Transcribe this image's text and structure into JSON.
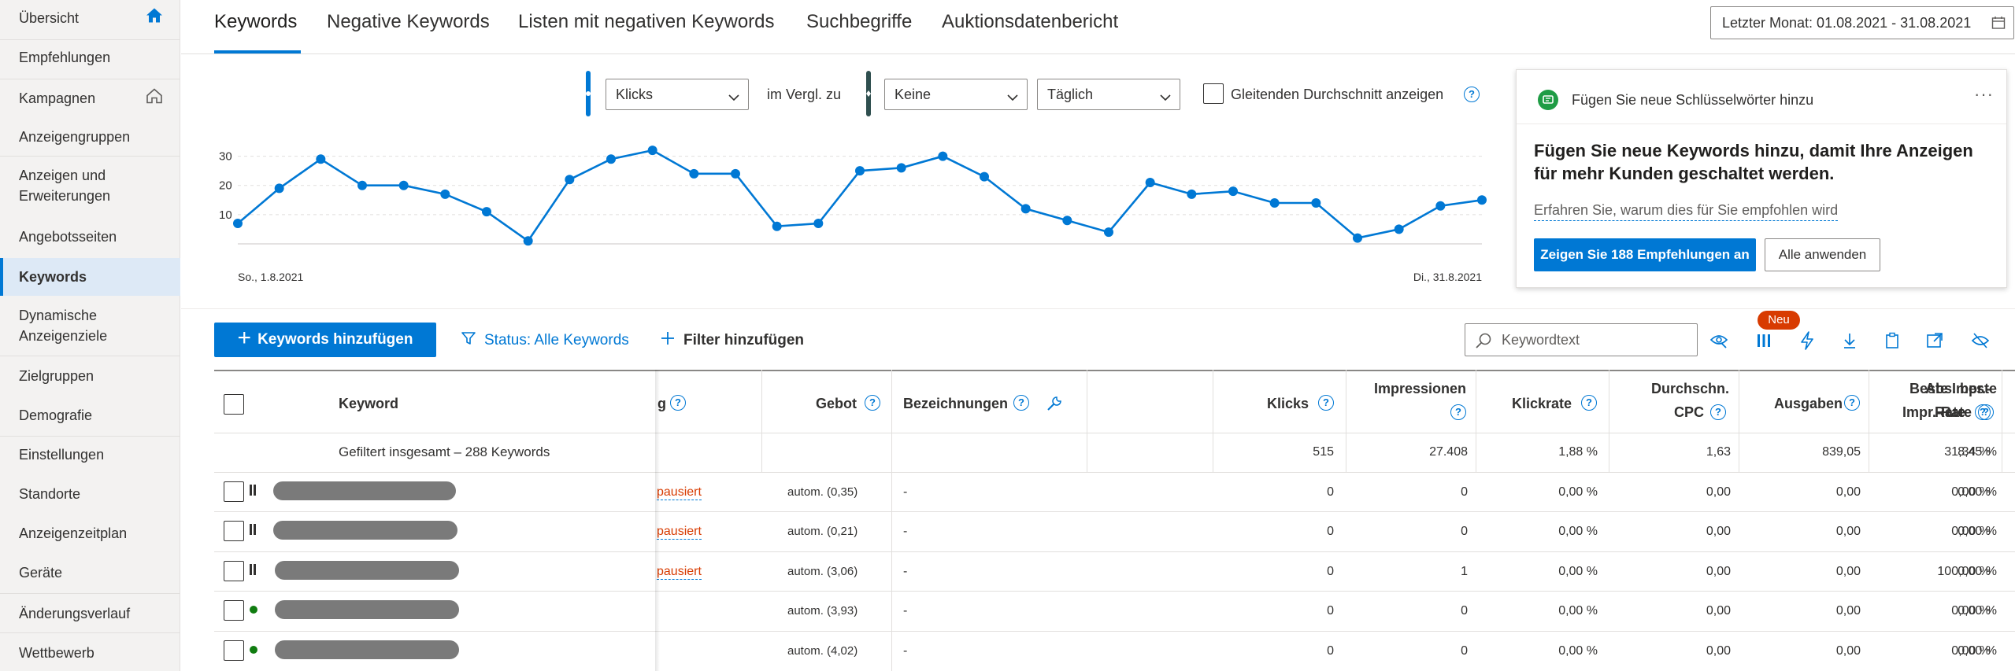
{
  "sidebar": {
    "items": [
      {
        "label": "Übersicht",
        "icon": "home-filled-icon"
      },
      {
        "label": "Empfehlungen"
      },
      {
        "label": "Kampagnen",
        "icon": "home-outline-icon"
      },
      {
        "label": "Anzeigengruppen"
      },
      {
        "label": "Anzeigen und Erweiterungen"
      },
      {
        "label": "Angebotsseiten"
      },
      {
        "label": "Keywords",
        "active": true
      },
      {
        "label": "Dynamische Anzeigenziele"
      },
      {
        "label": "Zielgruppen"
      },
      {
        "label": "Demografie"
      },
      {
        "label": "Einstellungen"
      },
      {
        "label": "Standorte"
      },
      {
        "label": "Anzeigenzeitplan"
      },
      {
        "label": "Geräte"
      },
      {
        "label": "Änderungsverlauf"
      },
      {
        "label": "Wettbewerb"
      }
    ]
  },
  "tabs": [
    {
      "label": "Keywords",
      "active": true
    },
    {
      "label": "Negative Keywords"
    },
    {
      "label": "Listen mit negativen Keywords"
    },
    {
      "label": "Suchbegriffe"
    },
    {
      "label": "Auktionsdatenbericht"
    }
  ],
  "date_range": "Letzter Monat: 01.08.2021 - 31.08.2021",
  "chart_controls": {
    "metric": "Klicks",
    "compare_label": "im Vergl. zu",
    "compare_metric": "Keine",
    "granularity": "Täglich",
    "moving_average_label": "Gleitenden Durchschnitt anzeigen"
  },
  "chart_data": {
    "type": "line",
    "x_start_label": "So., 1.8.2021",
    "x_end_label": "Di., 31.8.2021",
    "y_ticks": [
      "10",
      "20",
      "30"
    ],
    "ylim": [
      0,
      35
    ],
    "grid": true,
    "series": [
      {
        "color": "#0078d4",
        "values": [
          7,
          19,
          29,
          20,
          20,
          17,
          11,
          1,
          22,
          29,
          32,
          24,
          24,
          6,
          7,
          25,
          26,
          30,
          23,
          12,
          8,
          4,
          21,
          17,
          18,
          14,
          14,
          2,
          5,
          13,
          15
        ]
      }
    ]
  },
  "recommendation": {
    "title": "Fügen Sie neue Schlüsselwörter hinzu",
    "headline": "Fügen Sie neue Keywords hinzu, damit Ihre Anzeigen für mehr Kunden geschaltet werden.",
    "link": "Erfahren Sie, warum dies für Sie empfohlen wird",
    "primary_button": "Zeigen Sie 188 Empfehlungen an",
    "secondary_button": "Alle anwenden",
    "more": "···"
  },
  "toolbar": {
    "add_keywords": "Keywords hinzufügen",
    "status_filter": "Status: Alle Keywords",
    "add_filter": "Filter hinzufügen",
    "search_placeholder": "Keywordtext",
    "new_badge": "Neu"
  },
  "table": {
    "headers": {
      "keyword": "Keyword",
      "status_partial": "g",
      "bid": "Gebot",
      "labels": "Bezeichnungen",
      "clicks": "Klicks",
      "impressions_1": "Impressionen",
      "ctr": "Klickrate",
      "avg_cpc_1": "Durchschn.",
      "avg_cpc_2": "CPC",
      "spend": "Ausgaben",
      "top_impr_1": "Beste Impr.-",
      "top_impr_2": "Rate",
      "abs_top_1": "Abs. beste",
      "abs_top_2": "Impr.-Rate"
    },
    "totals": {
      "label": "Gefiltert insgesamt – 288 Keywords",
      "clicks": "515",
      "impressions": "27.408",
      "ctr": "1,88 %",
      "avg_cpc": "1,63",
      "spend": "839,05",
      "top_impr": "31,34 %",
      "abs_top": "8,45 %"
    },
    "rows": [
      {
        "state": "paused",
        "status": "pausiert",
        "bid": "autom. (0,35)",
        "labels": "-",
        "clicks": "0",
        "impressions": "0",
        "ctr": "0,00 %",
        "avg_cpc": "0,00",
        "spend": "0,00",
        "top_impr": "0,00 %",
        "abs_top": "0,00 %"
      },
      {
        "state": "paused",
        "status": "pausiert",
        "bid": "autom. (0,21)",
        "labels": "-",
        "clicks": "0",
        "impressions": "0",
        "ctr": "0,00 %",
        "avg_cpc": "0,00",
        "spend": "0,00",
        "top_impr": "0,00 %",
        "abs_top": "0,00 %"
      },
      {
        "state": "paused",
        "status": "pausiert",
        "bid": "autom. (3,06)",
        "labels": "-",
        "clicks": "0",
        "impressions": "1",
        "ctr": "0,00 %",
        "avg_cpc": "0,00",
        "spend": "0,00",
        "top_impr": "100,00 %",
        "abs_top": "0,00 %"
      },
      {
        "state": "active",
        "status": "",
        "bid": "autom. (3,93)",
        "labels": "-",
        "clicks": "0",
        "impressions": "0",
        "ctr": "0,00 %",
        "avg_cpc": "0,00",
        "spend": "0,00",
        "top_impr": "0,00 %",
        "abs_top": "0,00 %"
      },
      {
        "state": "active",
        "status": "",
        "bid": "autom. (4,02)",
        "labels": "-",
        "clicks": "0",
        "impressions": "0",
        "ctr": "0,00 %",
        "avg_cpc": "0,00",
        "spend": "0,00",
        "top_impr": "0,00 %",
        "abs_top": "0,00 %"
      }
    ]
  }
}
